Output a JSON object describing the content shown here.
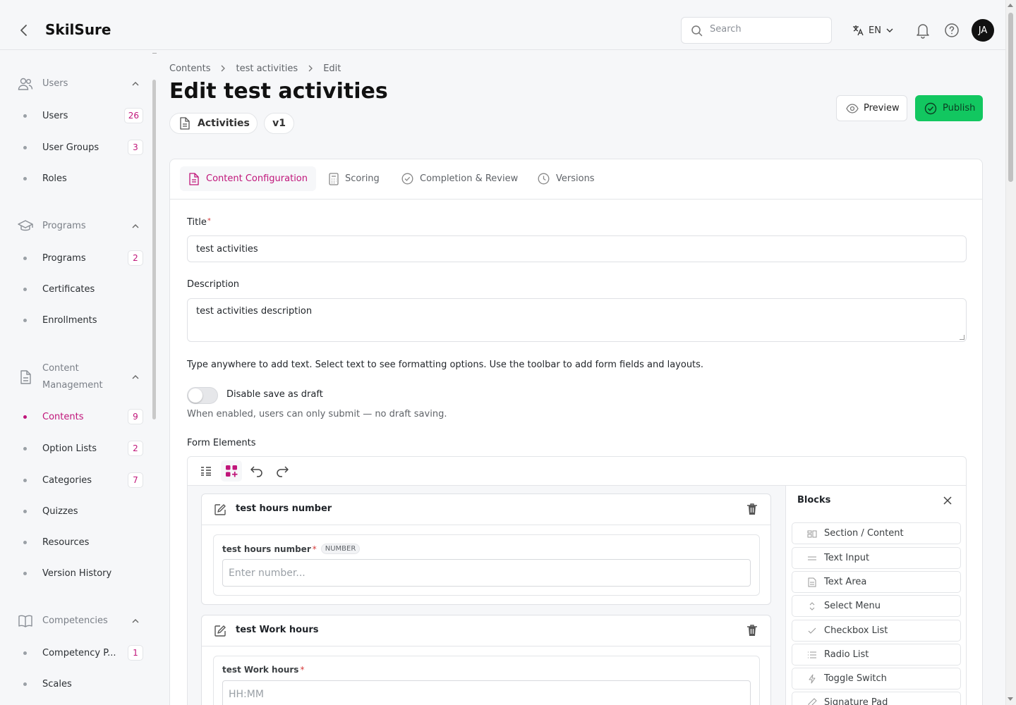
{
  "header": {
    "app_title": "SkilSure",
    "search_placeholder": "Search",
    "language": "EN",
    "avatar_initials": "JA"
  },
  "sidebar": {
    "groups": [
      {
        "label": "Users",
        "icon": "users-icon",
        "items": [
          {
            "label": "Users",
            "badge": "26"
          },
          {
            "label": "User Groups",
            "badge": "3"
          },
          {
            "label": "Roles",
            "badge": ""
          }
        ]
      },
      {
        "label": "Programs",
        "icon": "graduation-cap-icon",
        "items": [
          {
            "label": "Programs",
            "badge": "2"
          },
          {
            "label": "Certificates",
            "badge": ""
          },
          {
            "label": "Enrollments",
            "badge": ""
          }
        ]
      },
      {
        "label_line1": "Content",
        "label_line2": "Management",
        "icon": "document-icon",
        "items": [
          {
            "label": "Contents",
            "badge": "9",
            "active": true
          },
          {
            "label": "Option Lists",
            "badge": "2"
          },
          {
            "label": "Categories",
            "badge": "7"
          },
          {
            "label": "Quizzes",
            "badge": ""
          },
          {
            "label": "Resources",
            "badge": ""
          },
          {
            "label": "Version History",
            "badge": ""
          }
        ]
      },
      {
        "label": "Competencies",
        "icon": "book-icon",
        "items": [
          {
            "label": "Competency P...",
            "badge": "1"
          },
          {
            "label": "Scales",
            "badge": ""
          }
        ]
      }
    ]
  },
  "breadcrumb": [
    "Contents",
    "test activities",
    "Edit"
  ],
  "page": {
    "title": "Edit test activities",
    "type_chip": "Activities",
    "version_chip": "v1",
    "preview_label": "Preview",
    "publish_label": "Publish"
  },
  "tabs": [
    "Content Configuration",
    "Scoring",
    "Completion & Review",
    "Versions"
  ],
  "form": {
    "title_label": "Title",
    "title_value": "test activities",
    "description_label": "Description",
    "description_value": "test activities description",
    "helper_text": "Type anywhere to add text. Select text to see formatting options. Use the toolbar to add form fields and layouts.",
    "draft_toggle_label": "Disable save as draft",
    "draft_toggle_help": "When enabled, users can only submit — no draft saving.",
    "draft_toggle_on": false,
    "form_elements_label": "Form Elements"
  },
  "form_blocks": [
    {
      "title": "test hours number",
      "field_label": "test hours number",
      "type_tag": "NUMBER",
      "placeholder": "Enter number..."
    },
    {
      "title": "test Work hours",
      "field_label": "test Work hours",
      "type_tag": "",
      "placeholder": "HH:MM"
    }
  ],
  "blocks_panel": {
    "title": "Blocks",
    "items": [
      "Section / Content",
      "Text Input",
      "Text Area",
      "Select Menu",
      "Checkbox List",
      "Radio List",
      "Toggle Switch",
      "Signature Pad"
    ]
  },
  "colors": {
    "accent": "#c0157a",
    "publish": "#12c760"
  }
}
